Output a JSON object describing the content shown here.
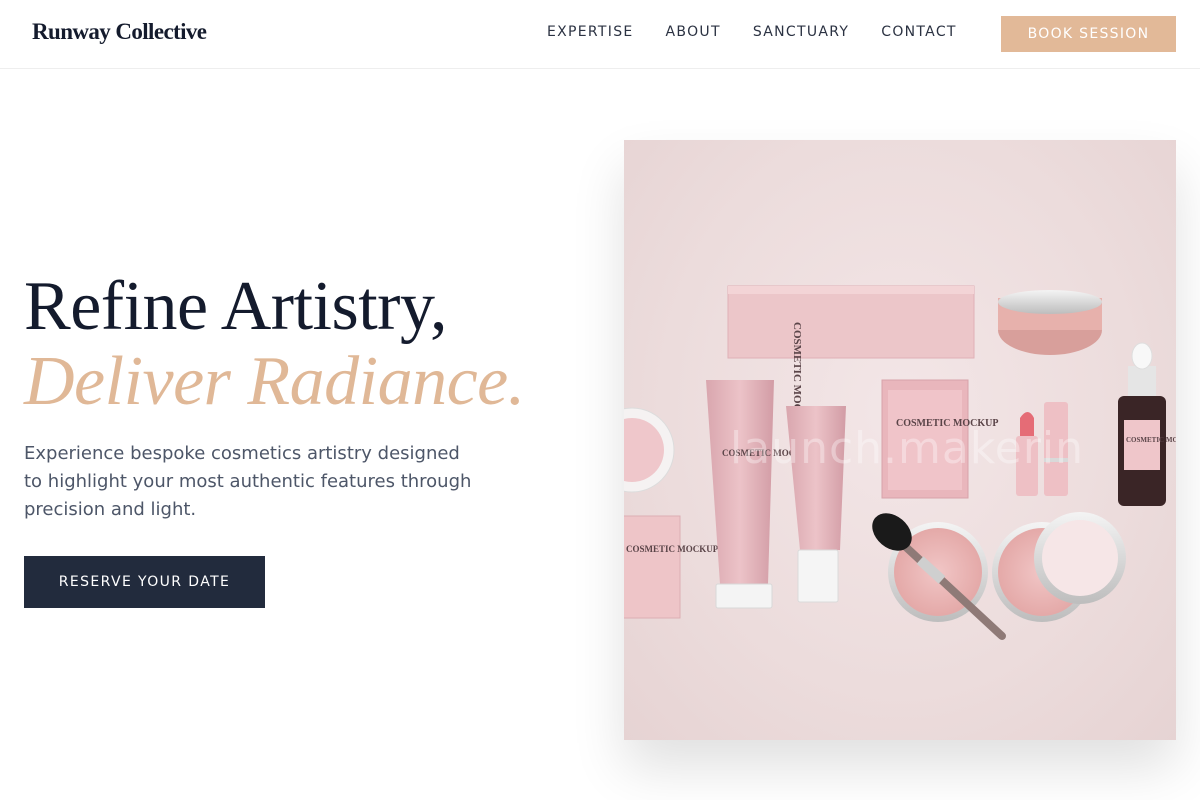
{
  "header": {
    "brand": "Runway Collective",
    "nav": [
      "EXPERTISE",
      "ABOUT",
      "SANCTUARY",
      "CONTACT"
    ],
    "cta": "BOOK SESSION"
  },
  "hero": {
    "headline_line1": "Refine Artistry,",
    "headline_line2": "Deliver Radiance.",
    "subtext": "Experience bespoke cosmetics artistry designed to highlight your most authentic features through precision and light.",
    "cta": "RESERVE YOUR DATE"
  },
  "image": {
    "watermark": "launch.makerin",
    "labels": {
      "box": "COSMETIC MOCKUP",
      "tube": "COSMETIC MOCKUP",
      "sachet": "COSMETIC MOCKUP",
      "bottle": "COSMETIC MOCKUP",
      "jar": "COSMETIC MOCKUP"
    }
  },
  "colors": {
    "accent": "#e2b998",
    "dark": "#222b3d",
    "headline": "#141b2d",
    "accent_text": "#e0b897",
    "body_text": "#4d5668",
    "product_pink": "#e9b9c0"
  }
}
